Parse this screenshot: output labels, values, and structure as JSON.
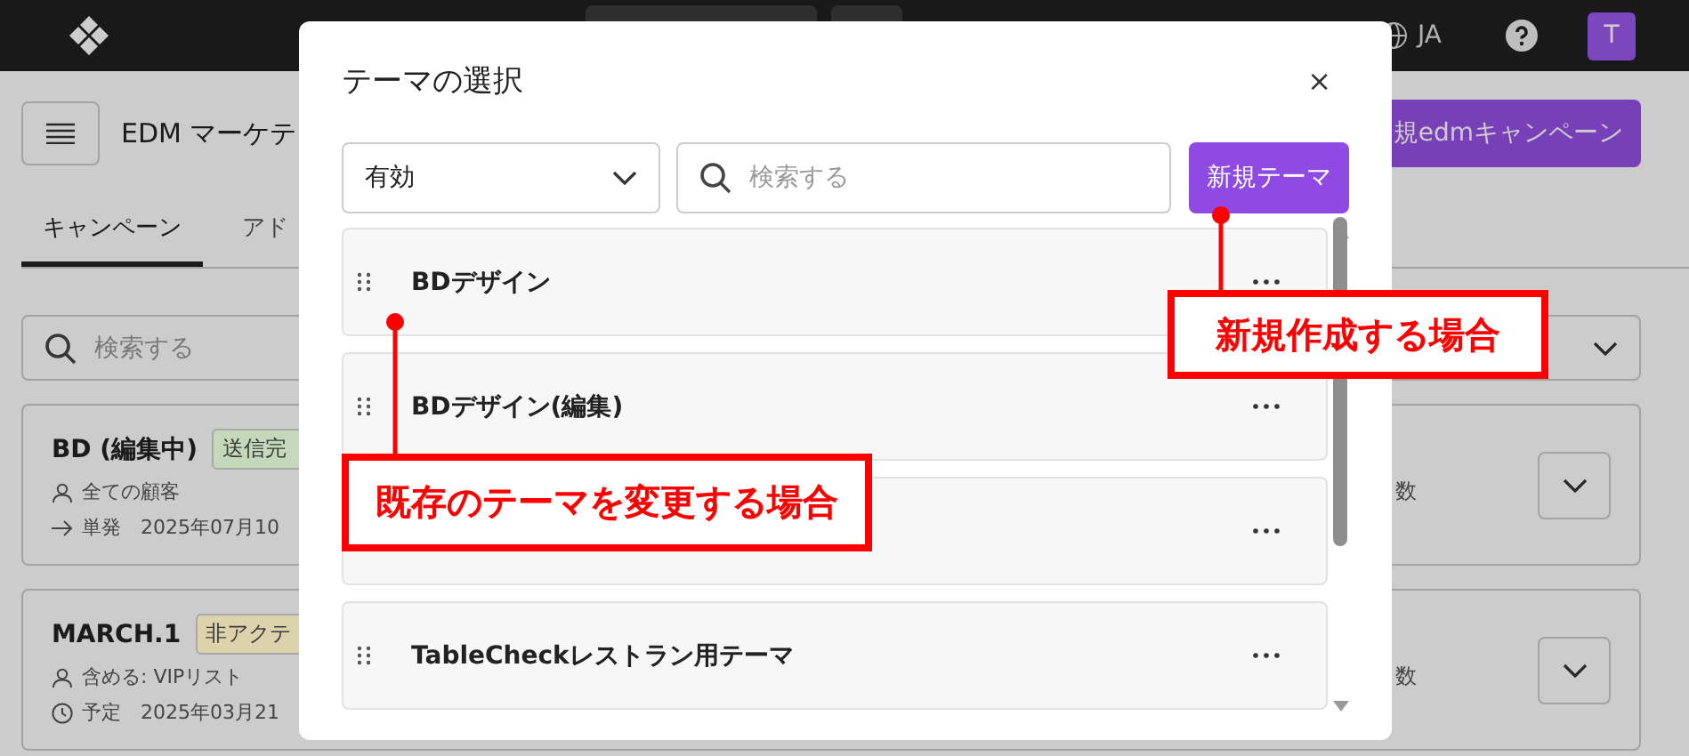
{
  "top_bar": {
    "language": "JA",
    "avatar": "T"
  },
  "header": {
    "title": "EDM マーケテ",
    "new_button": "規edmキャンペーン"
  },
  "tabs": [
    {
      "label": "キャンペーン",
      "selected": true
    },
    {
      "label": "アド",
      "selected": false
    }
  ],
  "search": {
    "placeholder": "検索する"
  },
  "campaigns": [
    {
      "name": "BD (編集中)",
      "status": {
        "text": "送信完",
        "color": "#c3d9ba"
      },
      "audience": "全ての顧客",
      "schedule": {
        "text": "単発",
        "kind": "single"
      },
      "date": "2025年07月10",
      "metric": "数"
    },
    {
      "name": "MARCH.1",
      "status": {
        "text": "非アクテ",
        "color": "#dcd2ac"
      },
      "audience": "含める: VIPリスト",
      "schedule": {
        "text": "予定",
        "kind": "scheduled"
      },
      "date": "2025年03月21",
      "metric": "数"
    }
  ],
  "modal": {
    "title": "テーマの選択",
    "close": "×",
    "filter": "有効",
    "search_placeholder": "検索する",
    "new_button": "新規テーマ",
    "themes": [
      {
        "name": "BDデザイン"
      },
      {
        "name": "BDデザイン(編集)"
      },
      {
        "covered": true
      },
      {
        "name": "TableCheckレストラン用テーマ"
      }
    ]
  },
  "callouts": [
    {
      "text": "新規作成する場合"
    },
    {
      "text": "既存のテーマを変更する場合"
    }
  ]
}
